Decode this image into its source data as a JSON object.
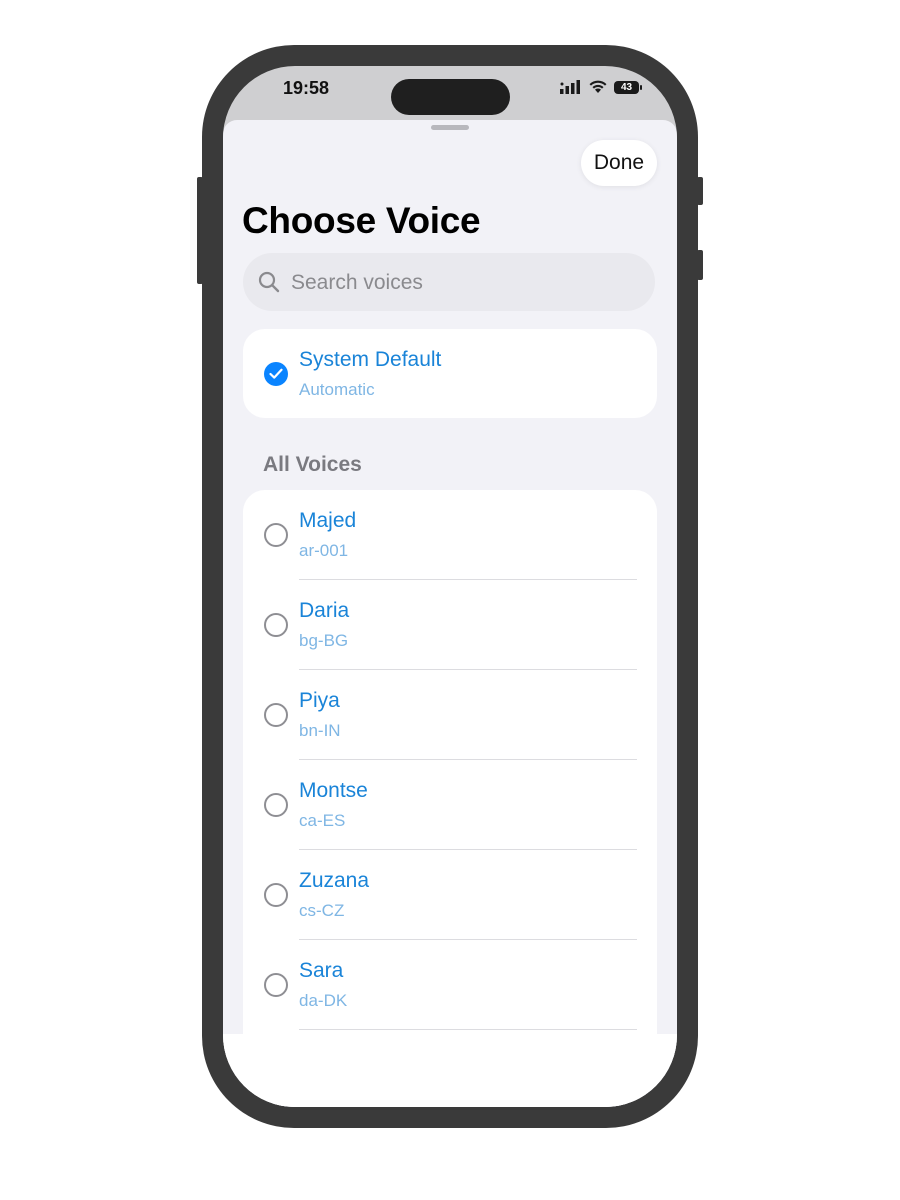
{
  "status_bar": {
    "time": "19:58",
    "battery": "43"
  },
  "sheet": {
    "done_label": "Done",
    "title": "Choose Voice",
    "search_placeholder": "Search voices"
  },
  "default_voice": {
    "name": "System Default",
    "subtitle": "Automatic",
    "selected": true
  },
  "section_label": "All Voices",
  "voices": [
    {
      "name": "Majed",
      "locale": "ar-001",
      "selected": false
    },
    {
      "name": "Daria",
      "locale": "bg-BG",
      "selected": false
    },
    {
      "name": "Piya",
      "locale": "bn-IN",
      "selected": false
    },
    {
      "name": "Montse",
      "locale": "ca-ES",
      "selected": false
    },
    {
      "name": "Zuzana",
      "locale": "cs-CZ",
      "selected": false
    },
    {
      "name": "Sara",
      "locale": "da-DK",
      "selected": false
    }
  ],
  "colors": {
    "accent": "#0a84ff",
    "voice_name": "#1a84d8",
    "voice_sub": "#7fb6e4",
    "frame": "#3a3a3a"
  },
  "icons": [
    "search-icon",
    "checkmark-icon",
    "radio-empty-icon",
    "signal-icon",
    "wifi-icon",
    "battery-icon"
  ]
}
